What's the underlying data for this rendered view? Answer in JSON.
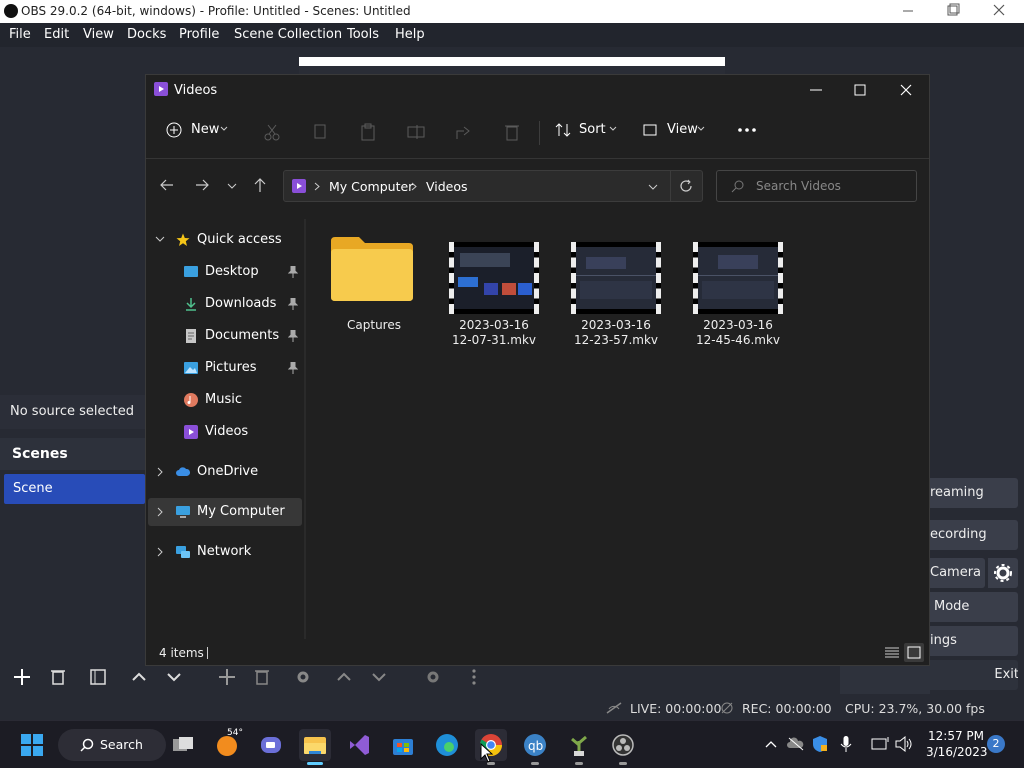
{
  "obs": {
    "title": "OBS 29.0.2 (64-bit, windows) - Profile: Untitled - Scenes: Untitled",
    "menu": [
      "File",
      "Edit",
      "View",
      "Docks",
      "Profile",
      "Scene Collection",
      "Tools",
      "Help"
    ],
    "no_source": "No source selected",
    "scenes_header": "Scenes",
    "scene_item": "Scene",
    "controls": [
      "reaming",
      "ecording",
      "Camera",
      "Mode",
      "ings",
      "Exit"
    ],
    "status": {
      "live": "LIVE: 00:00:00",
      "rec": "REC: 00:00:00",
      "cpu": "CPU: 23.7%, 30.00 fps"
    }
  },
  "explorer": {
    "title": "Videos",
    "cmd": {
      "new": "New",
      "sort": "Sort",
      "view": "View"
    },
    "breadcrumb": [
      "My Computer",
      "Videos"
    ],
    "search_placeholder": "Search Videos",
    "nav": [
      {
        "label": "Quick access",
        "icon": "star-icon"
      },
      {
        "label": "Desktop",
        "icon": "desktop-icon",
        "pinned": true
      },
      {
        "label": "Downloads",
        "icon": "download-icon",
        "pinned": true
      },
      {
        "label": "Documents",
        "icon": "document-icon",
        "pinned": true
      },
      {
        "label": "Pictures",
        "icon": "pictures-icon",
        "pinned": true
      },
      {
        "label": "Music",
        "icon": "music-icon"
      },
      {
        "label": "Videos",
        "icon": "videos-icon"
      },
      {
        "label": "OneDrive",
        "icon": "cloud-icon"
      },
      {
        "label": "My Computer",
        "icon": "computer-icon",
        "selected": true
      },
      {
        "label": "Network",
        "icon": "network-icon"
      }
    ],
    "files": [
      {
        "name": "Captures",
        "type": "folder"
      },
      {
        "name": "2023-03-16 12-07-31.mkv",
        "line1": "2023-03-16",
        "line2": "12-07-31.mkv",
        "type": "video"
      },
      {
        "name": "2023-03-16 12-23-57.mkv",
        "line1": "2023-03-16",
        "line2": "12-23-57.mkv",
        "type": "video"
      },
      {
        "name": "2023-03-16 12-45-46.mkv",
        "line1": "2023-03-16",
        "line2": "12-45-46.mkv",
        "type": "video"
      }
    ],
    "status": "4 items"
  },
  "taskbar": {
    "search": "Search",
    "weather_temp": "54°",
    "time": "12:57 PM",
    "date": "3/16/2023",
    "notifications": "2"
  },
  "colors": {
    "obs_bg": "#272a33",
    "scene_selected": "#284cb8",
    "explorer_bg": "#202020",
    "accent": "#60cdff",
    "folder": "#f3c13a"
  }
}
